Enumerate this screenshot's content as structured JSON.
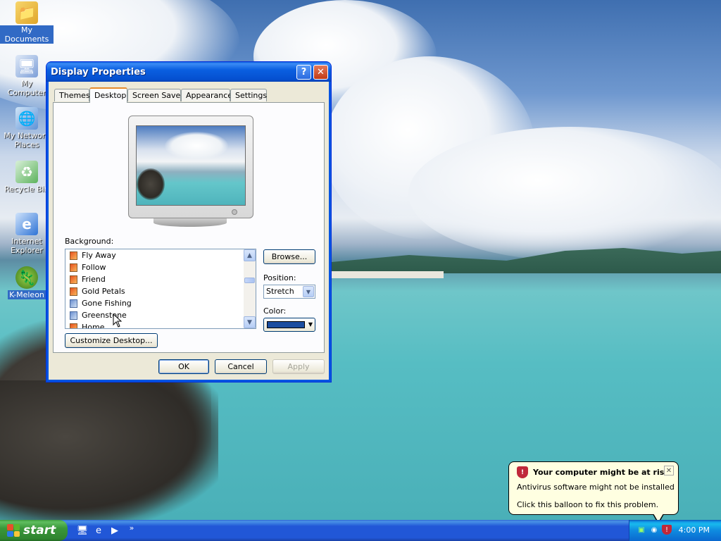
{
  "desktop_icons": [
    {
      "label": "My Documents",
      "icon": "folder-icon"
    },
    {
      "label": "My Computer",
      "icon": "computer-icon"
    },
    {
      "label": "My Network Places",
      "icon": "network-icon"
    },
    {
      "label": "Recycle Bin",
      "icon": "recycle-bin-icon"
    },
    {
      "label": "Internet Explorer",
      "icon": "ie-icon"
    },
    {
      "label": "K-Meleon",
      "icon": "k-meleon-icon"
    }
  ],
  "window": {
    "title": "Display Properties",
    "help_label": "?",
    "close_label": "✕",
    "tabs": [
      {
        "label": "Themes"
      },
      {
        "label": "Desktop"
      },
      {
        "label": "Screen Saver"
      },
      {
        "label": "Appearance"
      },
      {
        "label": "Settings"
      }
    ],
    "active_tab": "Desktop",
    "background_label": "Background:",
    "backgrounds": [
      {
        "label": "Fly Away"
      },
      {
        "label": "Follow"
      },
      {
        "label": "Friend"
      },
      {
        "label": "Gold Petals"
      },
      {
        "label": "Gone Fishing"
      },
      {
        "label": "Greenstone"
      },
      {
        "label": "Home"
      }
    ],
    "browse_label": "Browse...",
    "position_label": "Position:",
    "position_value": "Stretch",
    "color_label": "Color:",
    "color_value": "#1c4ea0",
    "customize_label": "Customize Desktop...",
    "ok_label": "OK",
    "cancel_label": "Cancel",
    "apply_label": "Apply"
  },
  "taskbar": {
    "start_label": "start",
    "clock": "4:00 PM"
  },
  "balloon": {
    "title": "Your computer might be at risk",
    "line1": "Antivirus software might not be installed",
    "line2": "Click this balloon to fix this problem.",
    "close_label": "✕"
  }
}
